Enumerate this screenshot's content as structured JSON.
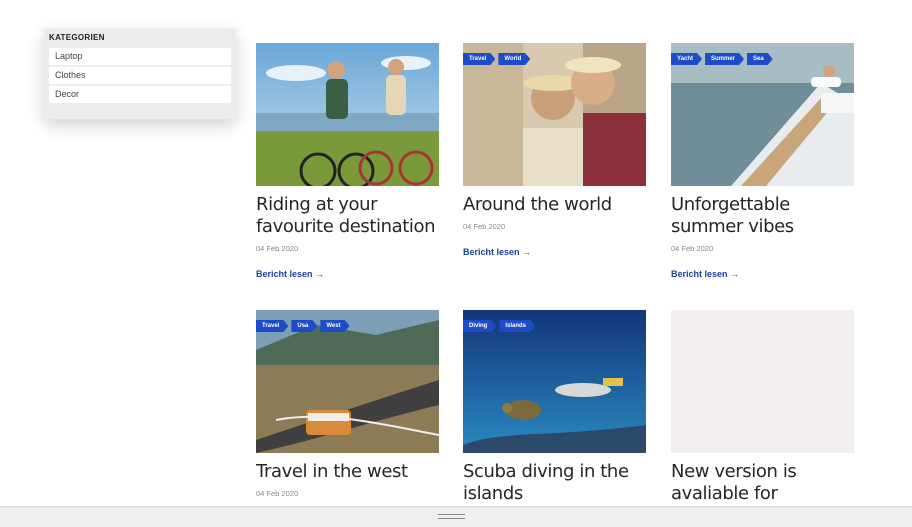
{
  "sidebar": {
    "title": "KATEGORIEN",
    "items": [
      {
        "label": "Laptop"
      },
      {
        "label": "Clothes"
      },
      {
        "label": "Decor"
      }
    ]
  },
  "read_more_label": "Bericht lesen →",
  "posts": [
    {
      "title": "Riding at your favourite destination",
      "date": "04 Feb 2020",
      "tags": []
    },
    {
      "title": "Around the world",
      "date": "04 Feb 2020",
      "tags": [
        "Travel",
        "World"
      ]
    },
    {
      "title": "Unforgettable summer vibes",
      "date": "04 Feb 2020",
      "tags": [
        "Yacht",
        "Summer",
        "Sea"
      ]
    },
    {
      "title": "Travel in the west",
      "date": "04 Feb 2020",
      "tags": [
        "Travel",
        "Usa",
        "West"
      ]
    },
    {
      "title": "Scuba diving in the islands",
      "date": "",
      "tags": [
        "Diving",
        "Islands"
      ]
    },
    {
      "title": "New version is avaliable for",
      "date": "",
      "tags": []
    }
  ],
  "colors": {
    "tag": "#1e4bc8",
    "link": "#1a3f9e",
    "placeholder": "#f2eeee"
  }
}
